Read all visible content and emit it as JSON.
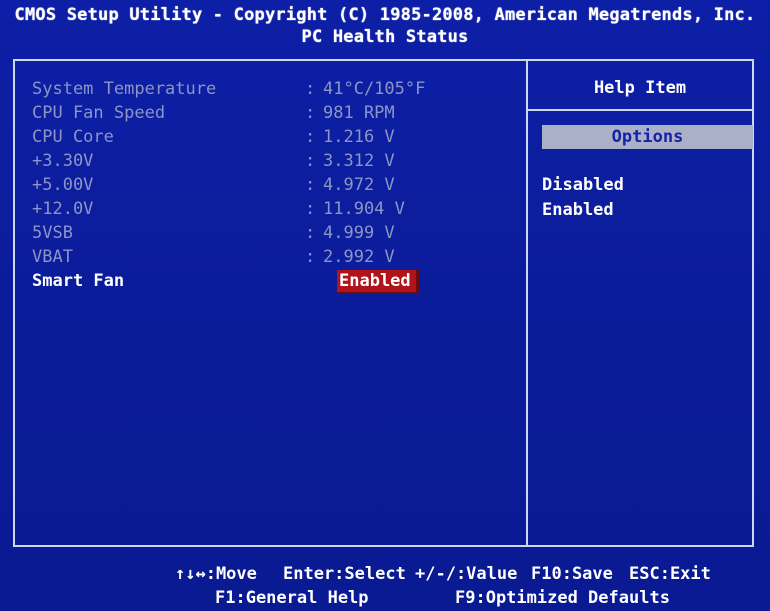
{
  "header": {
    "title": "CMOS Setup Utility - Copyright (C) 1985-2008, American Megatrends, Inc.",
    "subtitle": "PC Health Status"
  },
  "items": [
    {
      "label": "System Temperature",
      "value": "41°C/105°F"
    },
    {
      "label": "CPU Fan Speed",
      "value": "981 RPM"
    },
    {
      "label": "CPU Core",
      "value": "1.216 V"
    },
    {
      "label": "+3.30V",
      "value": "3.312 V"
    },
    {
      "label": "+5.00V",
      "value": "4.972 V"
    },
    {
      "label": "+12.0V",
      "value": "11.904 V"
    },
    {
      "label": "5VSB",
      "value": "4.999 V"
    },
    {
      "label": "VBAT",
      "value": "2.992 V"
    }
  ],
  "smart_fan": {
    "label": "Smart Fan",
    "value": "Enabled"
  },
  "help": {
    "title": "Help Item",
    "options_header": "Options",
    "options": [
      "Disabled",
      "Enabled"
    ]
  },
  "footer": {
    "move": "↑↓↔:Move",
    "select": "Enter:Select",
    "value": "+/-/:Value",
    "save": "F10:Save",
    "exit": "ESC:Exit",
    "help": "F1:General Help",
    "defaults": "F9:Optimized Defaults"
  },
  "colors": {
    "background": "#0b1c9a",
    "dim_text": "#8c95c6",
    "highlight": "#b0141a",
    "options_bar": "#aab0c8"
  }
}
